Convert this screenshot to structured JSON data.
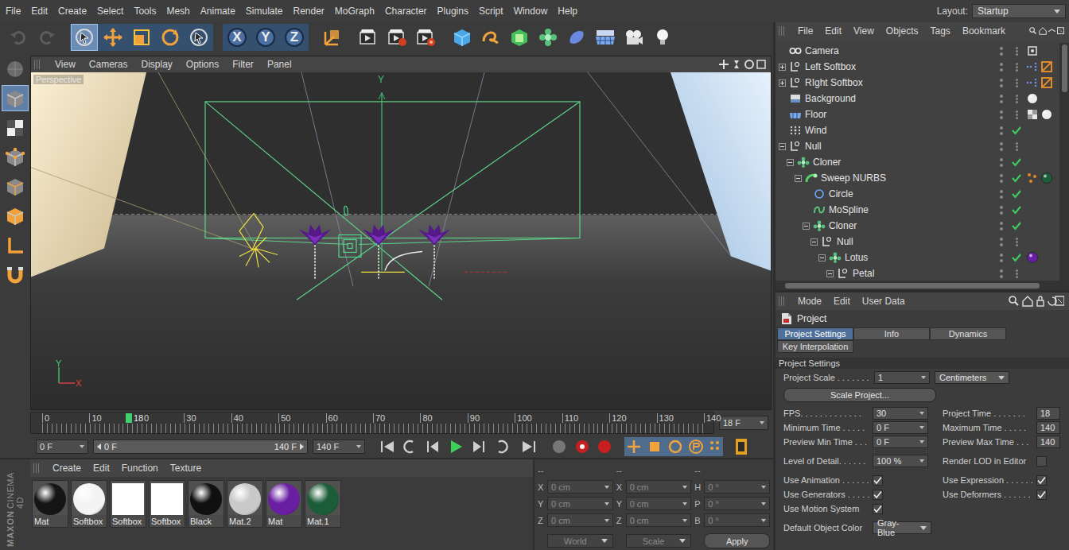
{
  "menu_bar": {
    "items": [
      "File",
      "Edit",
      "Create",
      "Select",
      "Tools",
      "Mesh",
      "Animate",
      "Simulate",
      "Render",
      "MoGraph",
      "Character",
      "Plugins",
      "Script",
      "Window",
      "Help"
    ],
    "layout_label": "Layout:",
    "layout_value": "Startup"
  },
  "toolbar": {
    "history": [
      {
        "kind": "undo",
        "disabled": true
      },
      {
        "kind": "redo",
        "disabled": true
      }
    ],
    "tools": [
      {
        "kind": "live-select",
        "selected": true
      },
      {
        "kind": "move",
        "selected": false
      },
      {
        "kind": "scale",
        "selected": false
      },
      {
        "kind": "rotate",
        "selected": false
      },
      {
        "kind": "recent",
        "selected": false
      }
    ],
    "axis_buttons": [
      {
        "label": "X",
        "on": true
      },
      {
        "label": "Y",
        "on": true
      },
      {
        "label": "Z",
        "on": true
      }
    ],
    "actions": [
      {
        "kind": "coords"
      },
      {
        "kind": "render-view"
      },
      {
        "kind": "picture-viewer"
      },
      {
        "kind": "render-settings"
      },
      {
        "kind": "cube"
      },
      {
        "kind": "pen"
      },
      {
        "kind": "nurbs"
      },
      {
        "kind": "cloner"
      },
      {
        "kind": "deformer"
      },
      {
        "kind": "floor"
      },
      {
        "kind": "camera"
      },
      {
        "kind": "light"
      }
    ]
  },
  "mode_bar": [
    {
      "kind": "workplane",
      "selected": false
    },
    {
      "kind": "model",
      "selected": true
    },
    {
      "kind": "texture",
      "selected": false
    },
    {
      "kind": "points",
      "selected": false
    },
    {
      "kind": "edges",
      "selected": false
    },
    {
      "kind": "polygons",
      "selected": false
    },
    {
      "kind": "axis",
      "selected": false
    },
    {
      "kind": "snap",
      "selected": false
    }
  ],
  "viewport": {
    "menu": [
      "View",
      "Cameras",
      "Display",
      "Options",
      "Filter",
      "Panel"
    ],
    "camera_label": "Perspective",
    "world_axis_label": "Y",
    "gizmo": {
      "y": "Y",
      "x": "X"
    }
  },
  "timeline": {
    "ticks": [
      "0",
      "10",
      "20",
      "30",
      "40",
      "50",
      "60",
      "70",
      "80",
      "90",
      "100",
      "110",
      "120",
      "130",
      "140"
    ],
    "current": "18",
    "level": 0.1286,
    "frame_field": "18 F"
  },
  "transport": {
    "start_field": "0 F",
    "range_start": "0 F",
    "range_end": "140 F",
    "end_field": "140 F"
  },
  "materials": {
    "menu": [
      "Create",
      "Edit",
      "Function",
      "Texture"
    ],
    "brand": [
      "MAXON",
      "CINEMA 4D"
    ],
    "items": [
      {
        "name": "Mat",
        "kind": "sphere",
        "color": "#151515"
      },
      {
        "name": "Softbox",
        "kind": "sphere",
        "color": "#f4f4f4"
      },
      {
        "name": "Softbox",
        "kind": "flat",
        "color": "#ffffff"
      },
      {
        "name": "Softbox",
        "kind": "flat",
        "color": "#ffffff"
      },
      {
        "name": "Black",
        "kind": "sphere",
        "color": "#101010"
      },
      {
        "name": "Mat.2",
        "kind": "sphere",
        "color": "#c9c9c9"
      },
      {
        "name": "Mat",
        "kind": "sphere",
        "color": "#6a1fa2"
      },
      {
        "name": "Mat.1",
        "kind": "sphere",
        "color": "#1d5c38"
      }
    ]
  },
  "coordinates": {
    "headers": [
      "--",
      "--",
      "--"
    ],
    "rows": [
      [
        {
          "label": "X",
          "value": "0 cm"
        },
        {
          "label": "X",
          "value": "0 cm"
        },
        {
          "label": "H",
          "value": "0 °"
        }
      ],
      [
        {
          "label": "Y",
          "value": "0 cm"
        },
        {
          "label": "Y",
          "value": "0 cm"
        },
        {
          "label": "P",
          "value": "0 °"
        }
      ],
      [
        {
          "label": "Z",
          "value": "0 cm"
        },
        {
          "label": "Z",
          "value": "0 cm"
        },
        {
          "label": "B",
          "value": "0 °"
        }
      ]
    ],
    "dropdowns": [
      "World",
      "Scale"
    ],
    "apply": "Apply"
  },
  "objects": {
    "menu": [
      "File",
      "Edit",
      "View",
      "Objects",
      "Tags",
      "Bookmark"
    ],
    "rows": [
      {
        "name": "Camera",
        "depth": 0,
        "has_children": false,
        "expanded": false,
        "kind": "camera",
        "checked": false,
        "tags": [
          {
            "kind": "protection",
            "color": "#dddddd"
          }
        ]
      },
      {
        "name": "Left Softbox",
        "depth": 0,
        "has_children": true,
        "expanded": false,
        "kind": "null",
        "checked": false,
        "tags": [
          {
            "kind": "target",
            "color": "#6f8fd8"
          },
          {
            "kind": "compositing",
            "color": "#e08a2a"
          }
        ]
      },
      {
        "name": "RIght Softbox",
        "depth": 0,
        "has_children": true,
        "expanded": false,
        "kind": "null",
        "checked": false,
        "tags": [
          {
            "kind": "target",
            "color": "#6f8fd8"
          },
          {
            "kind": "compositing",
            "color": "#e08a2a"
          }
        ]
      },
      {
        "name": "Background",
        "depth": 0,
        "has_children": false,
        "expanded": false,
        "kind": "background",
        "checked": false,
        "tags": [
          {
            "kind": "material",
            "color": "#eeeeee"
          }
        ]
      },
      {
        "name": "Floor",
        "depth": 0,
        "has_children": false,
        "expanded": false,
        "kind": "floor",
        "checked": false,
        "tags": [
          {
            "kind": "display",
            "color": "#9a9a9a"
          },
          {
            "kind": "material",
            "color": "#eeeeee"
          }
        ]
      },
      {
        "name": "Wind",
        "depth": 0,
        "has_children": false,
        "expanded": false,
        "kind": "wind",
        "checked": true,
        "tags": []
      },
      {
        "name": "Null",
        "depth": 0,
        "has_children": true,
        "expanded": true,
        "kind": "null",
        "checked": false,
        "tags": []
      },
      {
        "name": "Cloner",
        "depth": 1,
        "has_children": true,
        "expanded": true,
        "kind": "cloner",
        "checked": true,
        "tags": []
      },
      {
        "name": "Sweep NURBS",
        "depth": 2,
        "has_children": true,
        "expanded": true,
        "kind": "sweep",
        "checked": true,
        "tags": [
          {
            "kind": "mograph",
            "color": "#e08a2a"
          },
          {
            "kind": "material",
            "color": "#1d5c38"
          }
        ]
      },
      {
        "name": "Circle",
        "depth": 3,
        "has_children": false,
        "expanded": false,
        "kind": "circle",
        "checked": true,
        "tags": []
      },
      {
        "name": "MoSpline",
        "depth": 3,
        "has_children": false,
        "expanded": false,
        "kind": "mospline",
        "checked": true,
        "tags": []
      },
      {
        "name": "Cloner",
        "depth": 3,
        "has_children": true,
        "expanded": true,
        "kind": "cloner",
        "checked": true,
        "tags": []
      },
      {
        "name": "Null",
        "depth": 4,
        "has_children": true,
        "expanded": true,
        "kind": "null",
        "checked": false,
        "tags": []
      },
      {
        "name": "Lotus",
        "depth": 5,
        "has_children": true,
        "expanded": true,
        "kind": "cloner",
        "checked": true,
        "tags": [
          {
            "kind": "material",
            "color": "#6a1fa2"
          }
        ]
      },
      {
        "name": "Petal",
        "depth": 6,
        "has_children": true,
        "expanded": true,
        "kind": "null",
        "checked": false,
        "tags": []
      }
    ]
  },
  "attributes": {
    "menu": [
      "Mode",
      "Edit",
      "User Data"
    ],
    "title": "Project",
    "tabs": [
      {
        "label": "Project Settings",
        "selected": true
      },
      {
        "label": "Info",
        "selected": false
      },
      {
        "label": "Dynamics",
        "selected": false
      },
      {
        "label": "Key Interpolation",
        "selected": false
      }
    ],
    "section": "Project Settings",
    "scale": {
      "label": "Project Scale . . . . . . .",
      "value": "1",
      "unit": "Centimeters"
    },
    "scale_button": "Scale Project...",
    "groups": [
      [
        [
          {
            "label": "FPS. . . . . . . . . . . . .",
            "kind": "number",
            "value": "30"
          },
          {
            "label": "Project Time . . . . . . .",
            "kind": "number",
            "value": "18"
          }
        ],
        [
          {
            "label": "Minimum Time . . . . .",
            "kind": "number",
            "value": "0 F"
          },
          {
            "label": "Maximum Time . . . . .",
            "kind": "number",
            "value": "140"
          }
        ],
        [
          {
            "label": "Preview Min Time . . .",
            "kind": "number",
            "value": "0 F"
          },
          {
            "label": "Preview Max Time . . .",
            "kind": "number",
            "value": "140"
          }
        ]
      ],
      [
        [
          {
            "label": "Level of Detail. . . . . .",
            "kind": "number",
            "value": "100 %"
          },
          {
            "label": "Render LOD in Editor",
            "kind": "checkbox",
            "checked": false
          }
        ]
      ],
      [
        [
          {
            "label": "Use Animation . . . . . .",
            "kind": "checkbox",
            "checked": true
          },
          {
            "label": "Use Expression . . . . . .",
            "kind": "checkbox",
            "checked": true
          }
        ],
        [
          {
            "label": "Use Generators . . . . .",
            "kind": "checkbox",
            "checked": true
          },
          {
            "label": "Use Deformers . . . . . .",
            "kind": "checkbox",
            "checked": true
          }
        ],
        [
          {
            "label": "Use Motion System",
            "kind": "checkbox",
            "checked": true
          }
        ]
      ],
      [
        [
          {
            "label": "Default Object Color",
            "kind": "dropdown",
            "value": "Gray-Blue"
          }
        ]
      ]
    ]
  }
}
